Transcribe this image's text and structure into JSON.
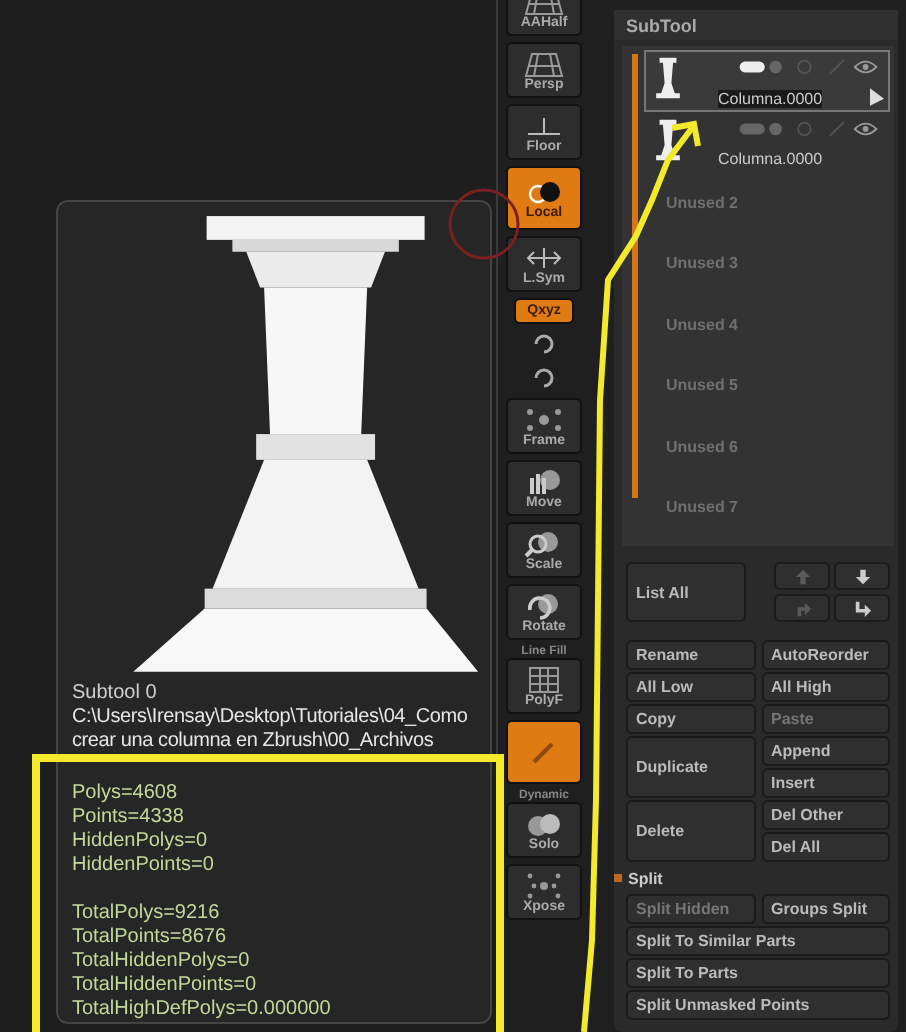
{
  "shelf": [
    {
      "kind": "button",
      "label": "AAHalf",
      "selected": false
    },
    {
      "kind": "button",
      "label": "Persp",
      "selected": false
    },
    {
      "kind": "button",
      "label": "Floor",
      "selected": false
    },
    {
      "kind": "tall",
      "label": "Local",
      "selected": true
    },
    {
      "kind": "button",
      "label": "L.Sym",
      "selected": false
    },
    {
      "kind": "small",
      "label": "Qxyz",
      "selected": true
    },
    {
      "kind": "icon",
      "selected": false
    },
    {
      "kind": "icon",
      "selected": false
    },
    {
      "kind": "button",
      "label": "Frame",
      "selected": false
    },
    {
      "kind": "button",
      "label": "Move",
      "selected": false
    },
    {
      "kind": "button",
      "label": "Scale",
      "selected": false
    },
    {
      "kind": "button",
      "label": "Rotate",
      "selected": false
    },
    {
      "kind": "double",
      "caption": "Line Fill",
      "label": "PolyF",
      "selected": false
    },
    {
      "kind": "tall",
      "selected": true
    },
    {
      "kind": "double",
      "caption": "Dynamic",
      "label": "Solo",
      "selected": false
    },
    {
      "kind": "button",
      "label": "Xpose",
      "selected": false
    }
  ],
  "popup": {
    "title": "Subtool 0",
    "path": [
      "C:\\Users\\Irensay\\Desktop\\Tutoriales\\04_Como",
      "crear una columna en Zbrush\\00_Archivos"
    ],
    "stats": [
      "Polys=4608",
      "Points=4338",
      "HiddenPolys=0",
      "HiddenPoints=0"
    ],
    "totals": [
      "TotalPolys=9216",
      "TotalPoints=8676",
      "TotalHiddenPolys=0",
      "TotalHiddenPoints=0",
      "TotalHighDefPolys=0.000000"
    ]
  },
  "subtool": {
    "title": "SubTool",
    "items": [
      {
        "kind": "mesh",
        "name": "Columna.0000",
        "selected": true
      },
      {
        "kind": "mesh",
        "name": "Columna.0000",
        "selected": false
      },
      {
        "kind": "empty",
        "name": "Unused 2",
        "selected": false
      },
      {
        "kind": "empty",
        "name": "Unused 3",
        "selected": false
      },
      {
        "kind": "empty",
        "name": "Unused 4",
        "selected": false
      },
      {
        "kind": "empty",
        "name": "Unused 5",
        "selected": false
      },
      {
        "kind": "empty",
        "name": "Unused 6",
        "selected": false
      },
      {
        "kind": "empty",
        "name": "Unused 7",
        "selected": false
      }
    ],
    "list_all": "List All",
    "arrows": [
      {
        "disabled": true
      },
      {
        "disabled": false
      },
      {
        "disabled": true
      },
      {
        "disabled": false
      }
    ],
    "rows": [
      {
        "kind": "pair",
        "items": [
          {
            "label": "Rename",
            "disabled": false
          },
          {
            "label": "AutoReorder",
            "disabled": false
          }
        ]
      },
      {
        "kind": "pair",
        "items": [
          {
            "label": "All Low",
            "disabled": false
          },
          {
            "label": "All High",
            "disabled": false
          }
        ]
      },
      {
        "kind": "pair",
        "items": [
          {
            "label": "Copy",
            "disabled": false
          },
          {
            "label": "Paste",
            "disabled": true
          }
        ]
      },
      {
        "kind": "tall",
        "items": [
          {
            "label": "Duplicate",
            "disabled": false
          },
          {
            "label": "Append",
            "disabled": false
          },
          {
            "label": "Insert",
            "disabled": false
          }
        ]
      },
      {
        "kind": "tall",
        "items": [
          {
            "label": "Delete",
            "disabled": false
          },
          {
            "label": "Del Other",
            "disabled": false
          },
          {
            "label": "Del All",
            "disabled": false
          }
        ]
      },
      {
        "kind": "section",
        "label": "Split"
      },
      {
        "kind": "pair",
        "items": [
          {
            "label": "Split Hidden",
            "disabled": true
          },
          {
            "label": "Groups Split",
            "disabled": false
          }
        ]
      },
      {
        "kind": "single",
        "items": [
          {
            "label": "Split To Similar Parts",
            "disabled": false
          }
        ]
      },
      {
        "kind": "single",
        "items": [
          {
            "label": "Split To Parts",
            "disabled": false
          }
        ]
      },
      {
        "kind": "single",
        "items": [
          {
            "label": "Split Unmasked Points",
            "disabled": false
          }
        ]
      }
    ]
  }
}
